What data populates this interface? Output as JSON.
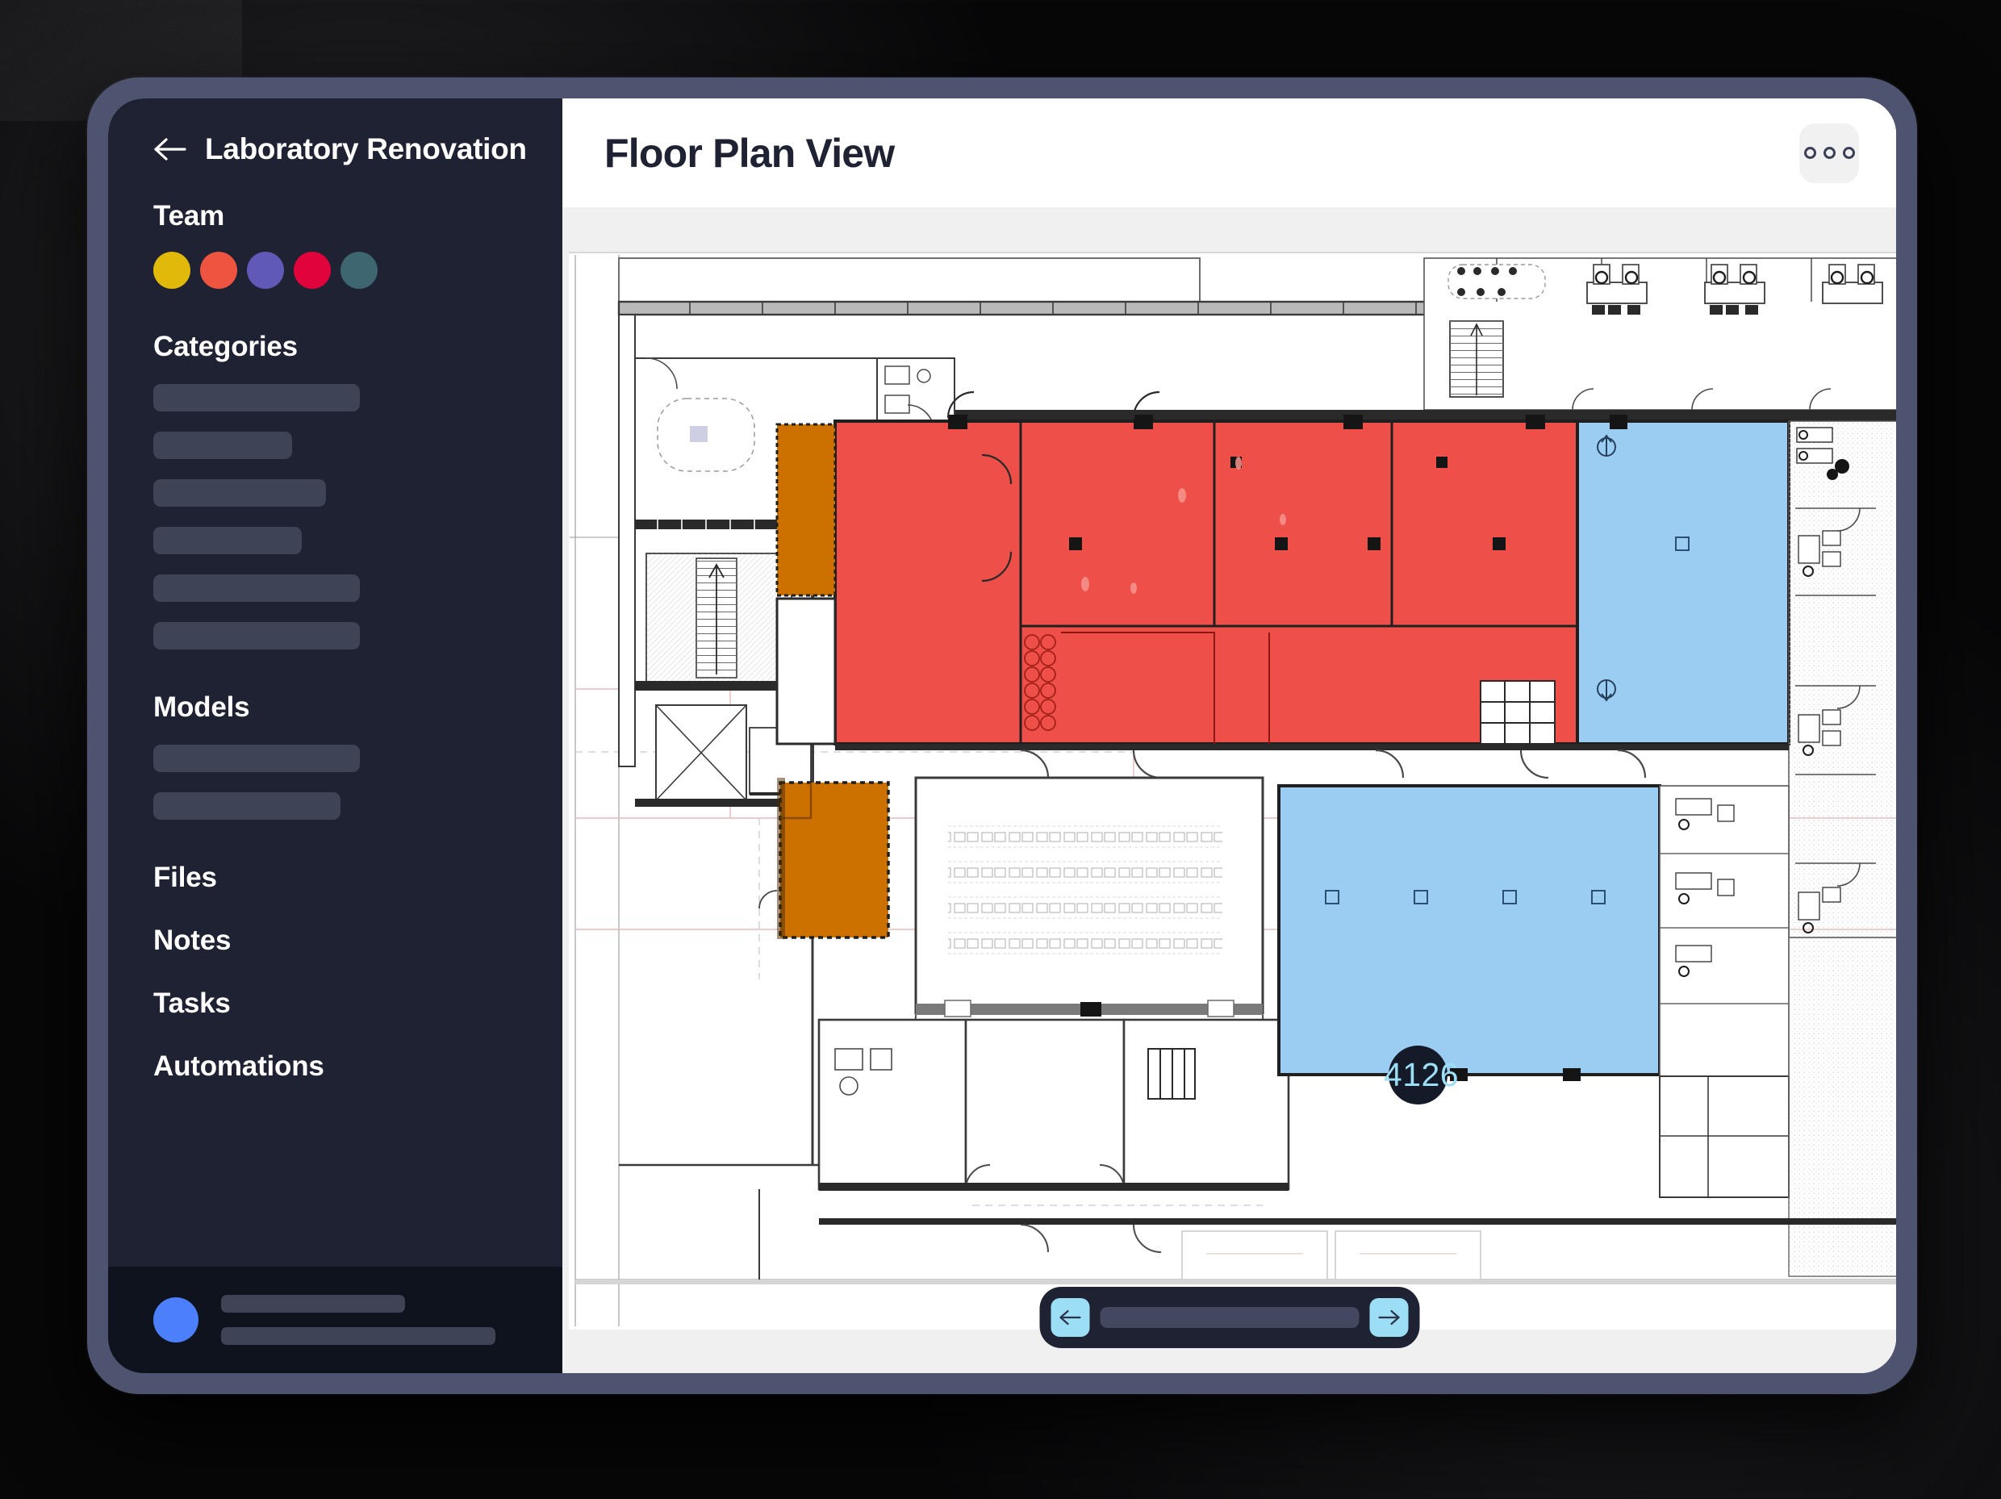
{
  "sidebar": {
    "back_icon": "arrow-left-icon",
    "project_title": "Laboratory Renovation",
    "team_heading": "Team",
    "team_members": [
      {
        "name": "member-1",
        "color": "#E0B90A"
      },
      {
        "name": "member-2",
        "color": "#EE5440"
      },
      {
        "name": "member-3",
        "color": "#6059B8"
      },
      {
        "name": "member-4",
        "color": "#E0033C"
      },
      {
        "name": "member-5",
        "color": "#3D6670"
      }
    ],
    "categories_heading": "Categories",
    "category_placeholder_widths": [
      256,
      172,
      214,
      184,
      256,
      256
    ],
    "models_heading": "Models",
    "model_placeholder_widths": [
      256,
      232
    ],
    "nav_items": [
      "Files",
      "Notes",
      "Tasks",
      "Automations"
    ],
    "footer": {
      "avatar_color": "#4C7FFB",
      "line_widths": [
        228,
        340
      ]
    }
  },
  "header": {
    "title": "Floor Plan View",
    "more_icon": "more-horizontal-icon",
    "more_dots": [
      "dot",
      "dot",
      "dot"
    ]
  },
  "canvas": {
    "marker": {
      "label": "4126",
      "text_color": "#9BDEF5",
      "bg_color": "#141A28"
    },
    "overlays": [
      {
        "name": "lab-zone-red",
        "color": "#EE5049"
      },
      {
        "name": "corridor-zone-orange",
        "color": "#CC7000"
      },
      {
        "name": "storage-zone-orange",
        "color": "#CC7000"
      },
      {
        "name": "east-hall-zone-blue",
        "color": "#9BCCF2"
      },
      {
        "name": "south-hall-zone-blue",
        "color": "#9BCCF2"
      }
    ]
  },
  "pager": {
    "prev_icon": "arrow-left-icon",
    "next_icon": "arrow-right-icon",
    "button_color": "#9BDEF5",
    "track_color": "#434860"
  }
}
